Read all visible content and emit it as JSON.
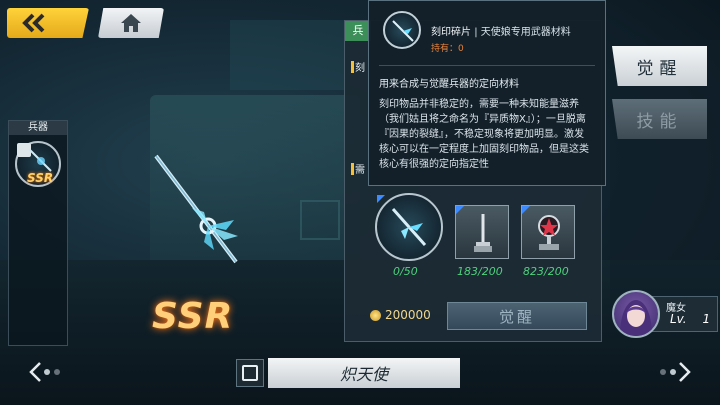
{
  "weapon_list": {
    "header": "兵器",
    "selected_rarity": "SSR"
  },
  "weapon": {
    "rarity": "SSR",
    "name": "炽天使"
  },
  "tooltip": {
    "title_name": "刻印碎片",
    "title_desc": "天使娘专用武器材料",
    "hold_label": "持有：",
    "hold_value": "0",
    "subtitle": "用来合成与觉醒兵器的定向材料",
    "body": "刻印物品并非稳定的，需要一种未知能量滋养（我们姑且将之命名为『异质物X』）；一旦脱离『因果的裂缝』，不稳定现象将更加明显。激发核心可以在一定程度上加固刻印物品，但是这类核心有很强的定向指定性"
  },
  "awaken_panel": {
    "tab_label": "兵",
    "side_mark_1": "刻",
    "side_mark_2": "需",
    "materials": [
      {
        "name": "刻印碎片",
        "count": "0/50",
        "count_color": "#4fd17d"
      },
      {
        "name": "sword-core",
        "count": "183/200",
        "count_color": "#4fd17d"
      },
      {
        "name": "pentagram-core",
        "count": "823/200",
        "count_color": "#4fd17d"
      }
    ],
    "cost": "200000",
    "awaken_button": "觉醒"
  },
  "side_buttons": {
    "awaken": "觉醒",
    "skill": "技能"
  },
  "character": {
    "name": "魔女",
    "level_label": "Lv.",
    "level": "1"
  },
  "colors": {
    "accent_yellow": "#f5c03a",
    "ssr_orange": "#ffcf7a",
    "count_green": "#4fd17d"
  }
}
